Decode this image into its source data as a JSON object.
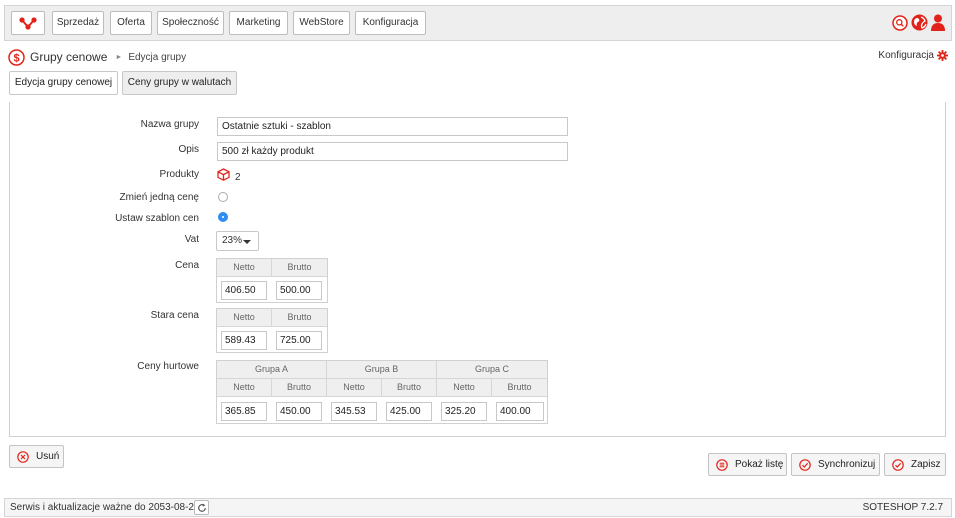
{
  "topnav": {
    "items": [
      {
        "label": "Sprzedaż"
      },
      {
        "label": "Oferta"
      },
      {
        "label": "Społeczność"
      },
      {
        "label": "Marketing"
      },
      {
        "label": "WebStore"
      },
      {
        "label": "Konfiguracja"
      }
    ]
  },
  "breadcrumb": {
    "title": "Grupy cenowe",
    "separator": "►",
    "current": "Edycja grupy"
  },
  "config_link": "Konfiguracja",
  "tabs": [
    {
      "label": "Edycja grupy cenowej",
      "active": true
    },
    {
      "label": "Ceny grupy w walutach",
      "active": false
    }
  ],
  "form": {
    "name_label": "Nazwa grupy",
    "name_value": "Ostatnie sztuki - szablon",
    "desc_label": "Opis",
    "desc_value": "500 zł każdy produkt",
    "products_label": "Produkty",
    "products_count": "2",
    "change_one_label": "Zmień jedną cenę",
    "change_one_checked": false,
    "template_label": "Ustaw szablon cen",
    "template_checked": true,
    "vat_label": "Vat",
    "vat_value": "23%",
    "price_label": "Cena",
    "price": {
      "netto_header": "Netto",
      "brutto_header": "Brutto",
      "netto": "406.50",
      "brutto": "500.00"
    },
    "old_price_label": "Stara cena",
    "old_price": {
      "netto_header": "Netto",
      "brutto_header": "Brutto",
      "netto": "589.43",
      "brutto": "725.00"
    },
    "wholesale_label": "Ceny hurtowe",
    "wholesale": {
      "groups": [
        {
          "name": "Grupa A",
          "netto_header": "Netto",
          "brutto_header": "Brutto",
          "netto": "365.85",
          "brutto": "450.00"
        },
        {
          "name": "Grupa B",
          "netto_header": "Netto",
          "brutto_header": "Brutto",
          "netto": "345.53",
          "brutto": "425.00"
        },
        {
          "name": "Grupa C",
          "netto_header": "Netto",
          "brutto_header": "Brutto",
          "netto": "325.20",
          "brutto": "400.00"
        }
      ]
    }
  },
  "buttons": {
    "delete": "Usuń",
    "show_list": "Pokaż listę",
    "sync": "Synchronizuj",
    "save": "Zapisz"
  },
  "status": {
    "service_text": "Serwis i aktualizacje ważne do 2053-08-26",
    "version": "SOTESHOP 7.2.7"
  },
  "colors": {
    "accent_red": "#e2231a",
    "radio_blue": "#2f8ef0"
  }
}
